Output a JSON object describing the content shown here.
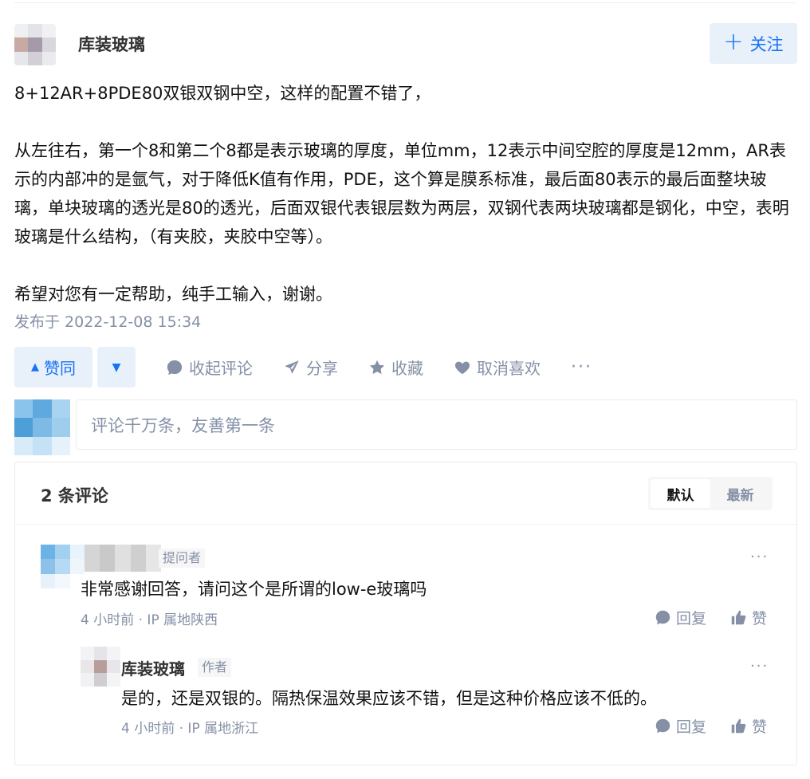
{
  "answer": {
    "author_name": "库装玻璃",
    "follow_label": "关注",
    "paragraphs": [
      "8+12AR+8PDE80双银双钢中空，这样的配置不错了，",
      "从左往右，第一个8和第二个8都是表示玻璃的厚度，单位mm，12表示中间空腔的厚度是12mm，AR表示的内部冲的是氩气，对于降低K值有作用，PDE，这个算是膜系标准，最后面80表示的最后面整块玻璃，单块玻璃的透光是80的透光，后面双银代表银层数为两层，双钢代表两块玻璃都是钢化，中空，表明玻璃是什么结构，（有夹胶，夹胶中空等）。",
      "希望对您有一定帮助，纯手工输入，谢谢。"
    ],
    "publish_text": "发布于 2022-12-08 15:34"
  },
  "actions": {
    "upvote_label": "赞同",
    "collapse_comments_label": "收起评论",
    "share_label": "分享",
    "favorite_label": "收藏",
    "unlike_label": "取消喜欢",
    "more_label": "···"
  },
  "comment_box": {
    "placeholder": "评论千万条，友善第一条"
  },
  "comments": {
    "title": "2 条评论",
    "sort_default": "默认",
    "sort_latest": "最新",
    "items": [
      {
        "tag": "提问者",
        "text": "非常感谢回答，请问这个是所谓的low-e玻璃吗",
        "meta": "4 小时前 · IP 属地陕西",
        "reply_label": "回复",
        "like_label": "赞",
        "more_label": "···"
      },
      {
        "name": "库装玻璃",
        "tag": "作者",
        "text": "是的，还是双银的。隔热保温效果应该不错，但是这种价格应该不低的。",
        "meta": "4 小时前 · IP 属地浙江",
        "reply_label": "回复",
        "like_label": "赞",
        "more_label": "···"
      }
    ]
  },
  "colors": {
    "accent": "#1772f6",
    "accent_bg": "#e8f0fa",
    "muted": "#8590a6"
  }
}
